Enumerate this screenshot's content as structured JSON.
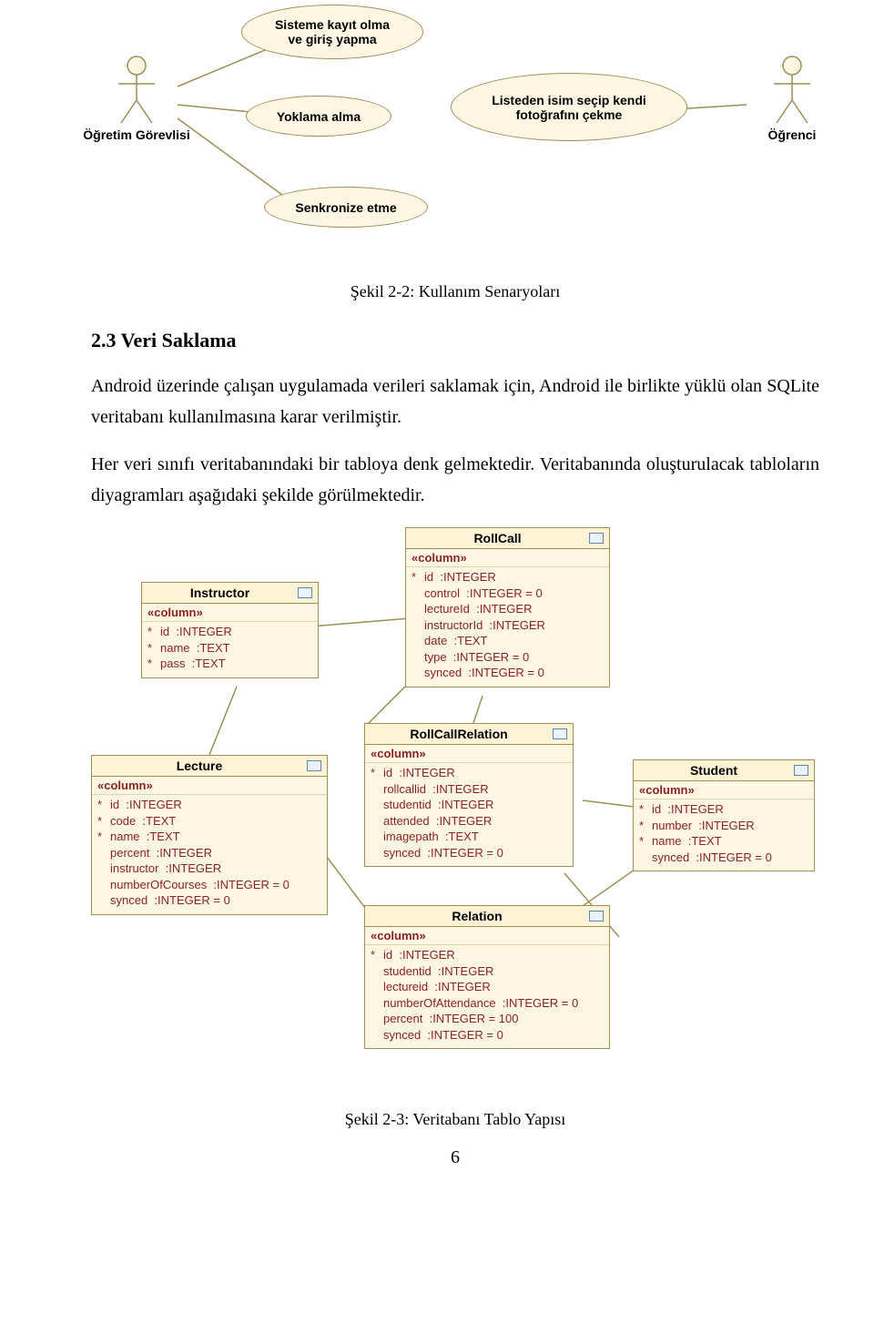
{
  "usecase": {
    "actors": {
      "left": "Öğretim Görevlisi",
      "right": "Öğrenci"
    },
    "uc1": "Sisteme kayıt olma\nve giriş yapma",
    "uc2": "Yoklama alma",
    "uc3": "Senkronize etme",
    "uc4": "Listeden isim seçip kendi\nfotoğrafını çekme"
  },
  "caption1": "Şekil 2-2: Kullanım Senaryoları",
  "sectionTitle": "2.3 Veri Saklama",
  "para1": "Android üzerinde çalışan uygulamada verileri saklamak için, Android ile birlikte yüklü olan SQLite veritabanı kullanılmasına karar verilmiştir.",
  "para2": "Her veri sınıfı veritabanındaki bir tabloya denk gelmektedir. Veritabanında oluşturulacak tabloların diyagramları aşağıdaki şekilde görülmektedir.",
  "er": {
    "stereotype": "«column»",
    "instructor": {
      "name": "Instructor",
      "cols": [
        {
          "s": "*",
          "t": "id  :INTEGER"
        },
        {
          "s": "*",
          "t": "name  :TEXT"
        },
        {
          "s": "*",
          "t": "pass  :TEXT"
        }
      ]
    },
    "rollcall": {
      "name": "RollCall",
      "cols": [
        {
          "s": "*",
          "t": "id  :INTEGER"
        },
        {
          "s": "",
          "t": "control  :INTEGER = 0"
        },
        {
          "s": "",
          "t": "lectureId  :INTEGER"
        },
        {
          "s": "",
          "t": "instructorId  :INTEGER"
        },
        {
          "s": "",
          "t": "date  :TEXT"
        },
        {
          "s": "",
          "t": "type  :INTEGER = 0"
        },
        {
          "s": "",
          "t": "synced  :INTEGER = 0"
        }
      ]
    },
    "lecture": {
      "name": "Lecture",
      "cols": [
        {
          "s": "*",
          "t": "id  :INTEGER"
        },
        {
          "s": "*",
          "t": "code  :TEXT"
        },
        {
          "s": "*",
          "t": "name  :TEXT"
        },
        {
          "s": "",
          "t": "percent  :INTEGER"
        },
        {
          "s": "",
          "t": "instructor  :INTEGER"
        },
        {
          "s": "",
          "t": "numberOfCourses  :INTEGER = 0"
        },
        {
          "s": "",
          "t": "synced  :INTEGER = 0"
        }
      ]
    },
    "rollcallrel": {
      "name": "RollCallRelation",
      "cols": [
        {
          "s": "*",
          "t": "id  :INTEGER"
        },
        {
          "s": "",
          "t": "rollcallid  :INTEGER"
        },
        {
          "s": "",
          "t": "studentid  :INTEGER"
        },
        {
          "s": "",
          "t": "attended  :INTEGER"
        },
        {
          "s": "",
          "t": "imagepath  :TEXT"
        },
        {
          "s": "",
          "t": "synced  :INTEGER = 0"
        }
      ]
    },
    "student": {
      "name": "Student",
      "cols": [
        {
          "s": "*",
          "t": "id  :INTEGER"
        },
        {
          "s": "*",
          "t": "number  :INTEGER"
        },
        {
          "s": "*",
          "t": "name  :TEXT"
        },
        {
          "s": "",
          "t": "synced  :INTEGER = 0"
        }
      ]
    },
    "relation": {
      "name": "Relation",
      "cols": [
        {
          "s": "*",
          "t": "id  :INTEGER"
        },
        {
          "s": "",
          "t": "studentid  :INTEGER"
        },
        {
          "s": "",
          "t": "lectureid  :INTEGER"
        },
        {
          "s": "",
          "t": "numberOfAttendance  :INTEGER = 0"
        },
        {
          "s": "",
          "t": "percent  :INTEGER = 100"
        },
        {
          "s": "",
          "t": "synced  :INTEGER = 0"
        }
      ]
    }
  },
  "caption2": "Şekil 2-3: Veritabanı Tablo Yapısı",
  "pageNumber": "6"
}
